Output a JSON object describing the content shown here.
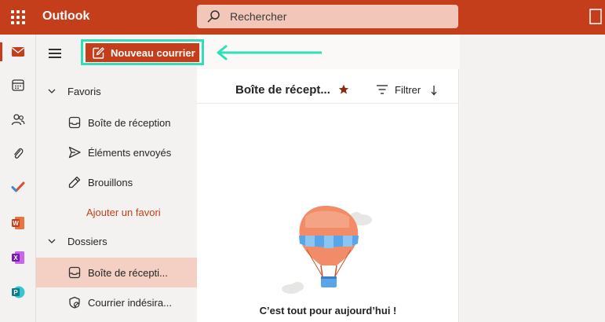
{
  "app": {
    "title": "Outlook"
  },
  "search": {
    "placeholder": "Rechercher"
  },
  "rail": {
    "items": [
      {
        "name": "mail-icon",
        "active": true
      },
      {
        "name": "calendar-icon"
      },
      {
        "name": "people-icon"
      },
      {
        "name": "attachment-icon"
      },
      {
        "name": "todo-icon"
      },
      {
        "name": "word-icon"
      },
      {
        "name": "onenote-icon"
      },
      {
        "name": "powerpoint-icon"
      }
    ]
  },
  "toolbar": {
    "new_mail_label": "Nouveau courrier"
  },
  "folders": {
    "favorites_label": "Favoris",
    "favorites": [
      {
        "label": "Boîte de réception",
        "icon": "inbox-icon"
      },
      {
        "label": "Éléments envoyés",
        "icon": "send-icon"
      },
      {
        "label": "Brouillons",
        "icon": "pencil-icon"
      }
    ],
    "add_favorite_label": "Ajouter un favori",
    "folders_label": "Dossiers",
    "folders": [
      {
        "label": "Boîte de récepti...",
        "icon": "inbox-icon",
        "selected": true
      },
      {
        "label": "Courrier indésira...",
        "icon": "junk-icon"
      }
    ]
  },
  "message_list": {
    "title": "Boîte de récept...",
    "filter_label": "Filtrer",
    "empty_text": "C’est tout pour aujourd’hui !"
  },
  "colors": {
    "brand": "#c43e1c",
    "highlight": "#2de0b6",
    "selected_row": "#f4cfc4"
  }
}
